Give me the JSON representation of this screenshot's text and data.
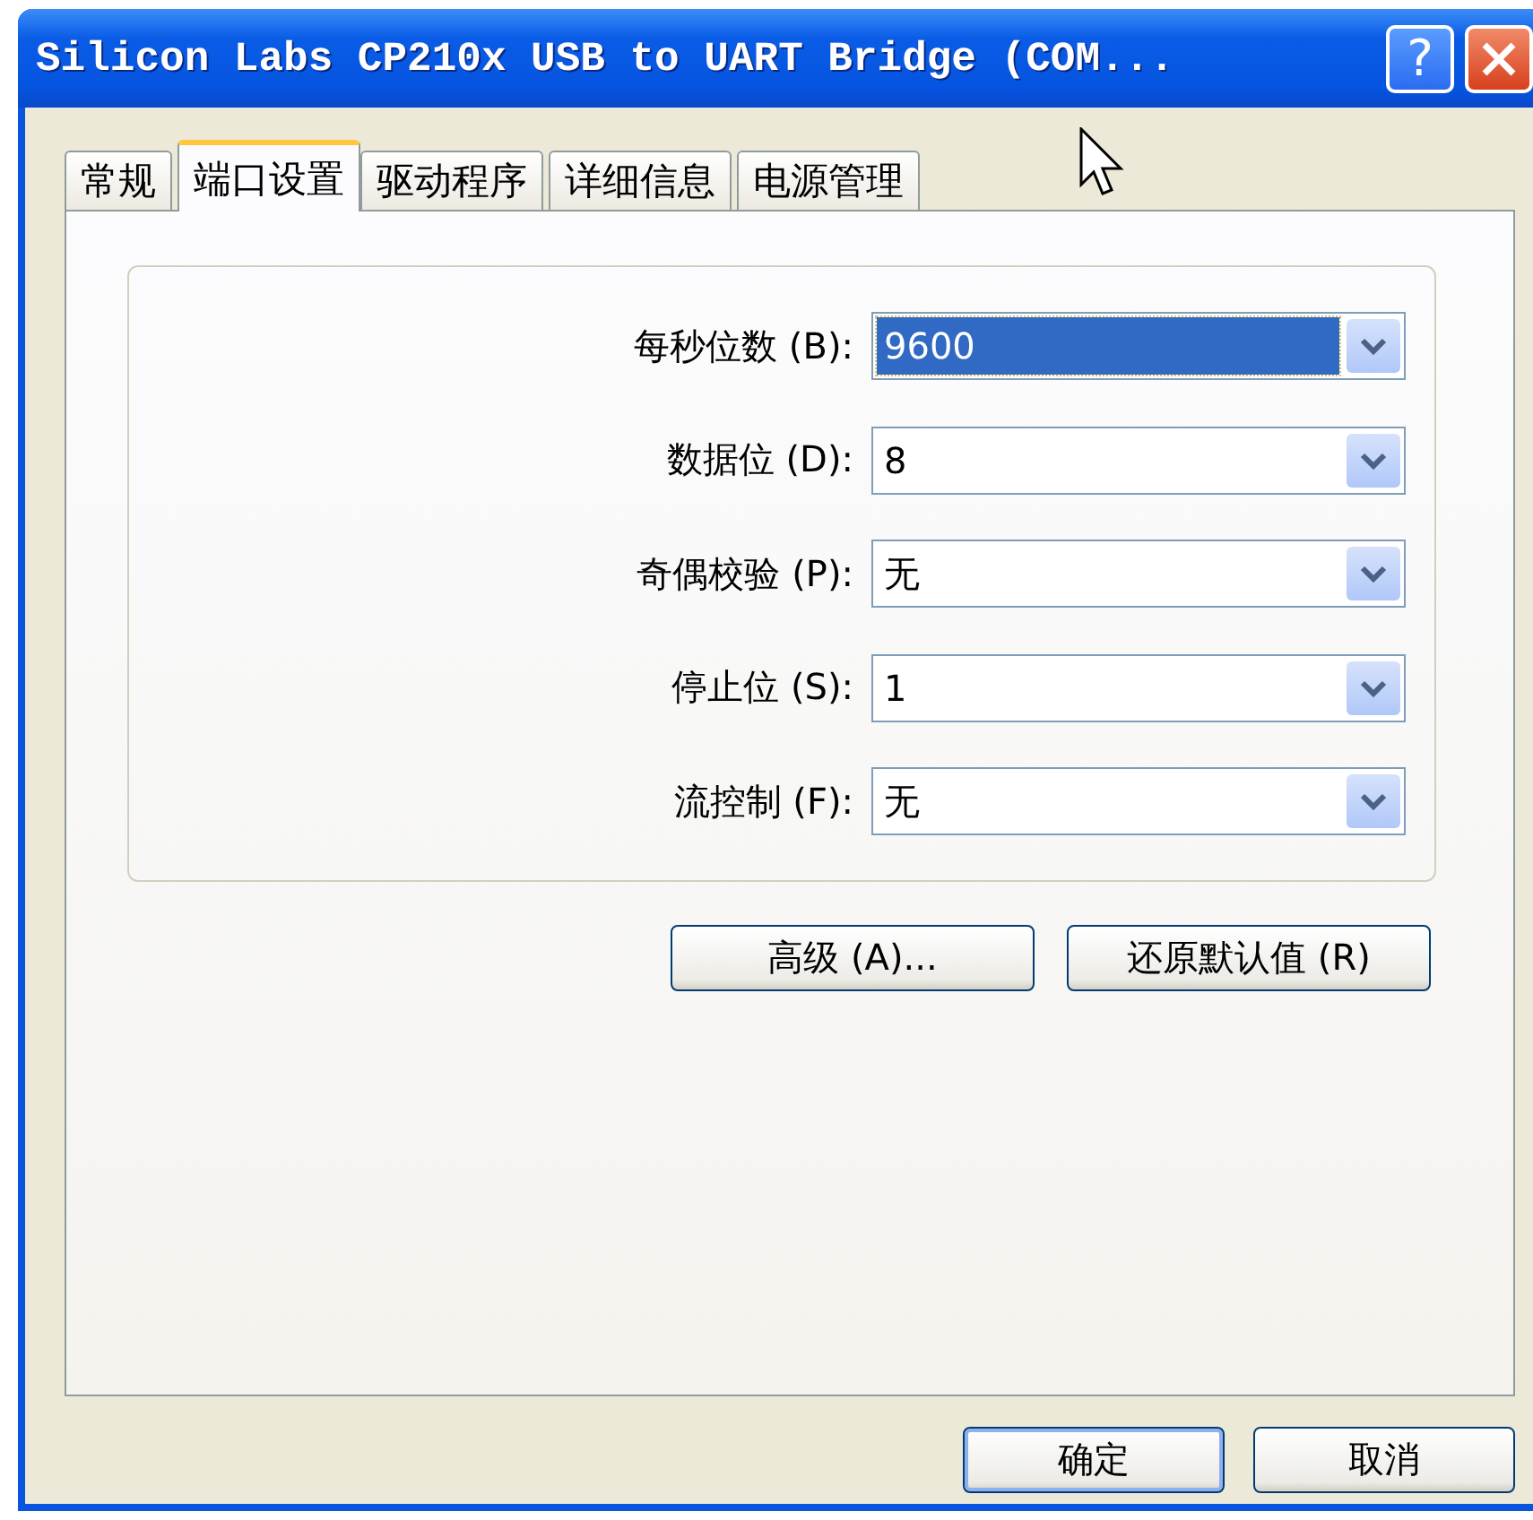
{
  "window": {
    "title": "Silicon Labs CP210x USB to UART Bridge (COM..."
  },
  "title_buttons": [
    {
      "kind": "help",
      "label": "?"
    },
    {
      "kind": "close"
    }
  ],
  "tabs": [
    {
      "label": "常规",
      "selected": false
    },
    {
      "label": "端口设置",
      "selected": true
    },
    {
      "label": "驱动程序",
      "selected": false
    },
    {
      "label": "详细信息",
      "selected": false
    },
    {
      "label": "电源管理",
      "selected": false
    }
  ],
  "settings": [
    {
      "label": "每秒位数 (B):",
      "value": "9600",
      "focused": true
    },
    {
      "label": "数据位 (D):",
      "value": "8",
      "focused": false
    },
    {
      "label": "奇偶校验 (P):",
      "value": "无",
      "focused": false
    },
    {
      "label": "停止位 (S):",
      "value": "1",
      "focused": false
    },
    {
      "label": "流控制 (F):",
      "value": "无",
      "focused": false
    }
  ],
  "panel_buttons": [
    "高级 (A)...",
    "还原默认值 (R)"
  ],
  "dialog_buttons": [
    {
      "label": "确定",
      "default": true
    },
    {
      "label": "取消",
      "default": false
    }
  ]
}
